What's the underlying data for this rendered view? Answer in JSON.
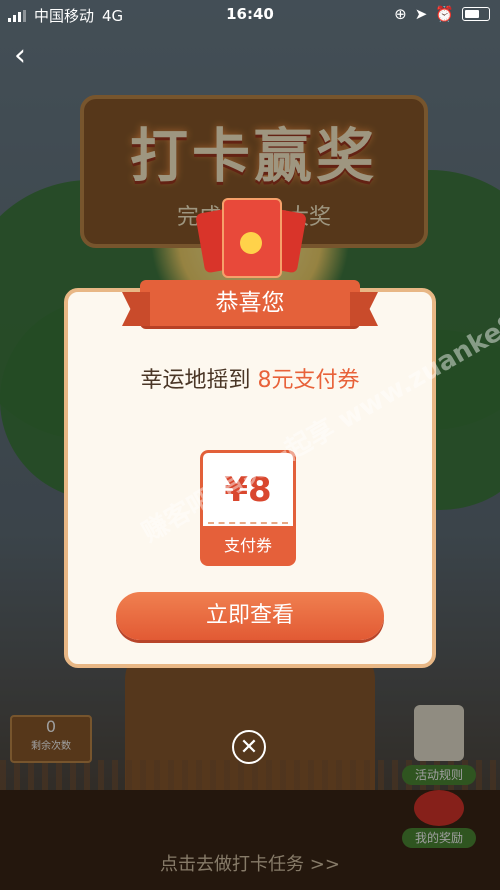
{
  "status_bar": {
    "carrier": "中国移动",
    "network": "4G",
    "time": "16:40"
  },
  "banner": {
    "title": "打卡赢奖",
    "subtitle": "完成打卡抽大奖"
  },
  "remaining": {
    "count": "0",
    "label": "剩余次数"
  },
  "side_buttons": {
    "rules": "活动规则",
    "my_prizes": "我的奖励"
  },
  "modal": {
    "ribbon": "恭喜您",
    "message_prefix": "幸运地摇到",
    "message_highlight": "8元支付券",
    "coupon_amount": "¥8",
    "coupon_label": "支付券",
    "action_button": "立即查看",
    "close_symbol": "✕"
  },
  "bottom_link": "点击去做打卡任务 >>",
  "watermark": "赚客吧 有奖一起享 www.zuanke8.com",
  "colors": {
    "accent": "#e25a34",
    "modal_bg": "#fdf8ef",
    "modal_border": "#e8b785"
  }
}
